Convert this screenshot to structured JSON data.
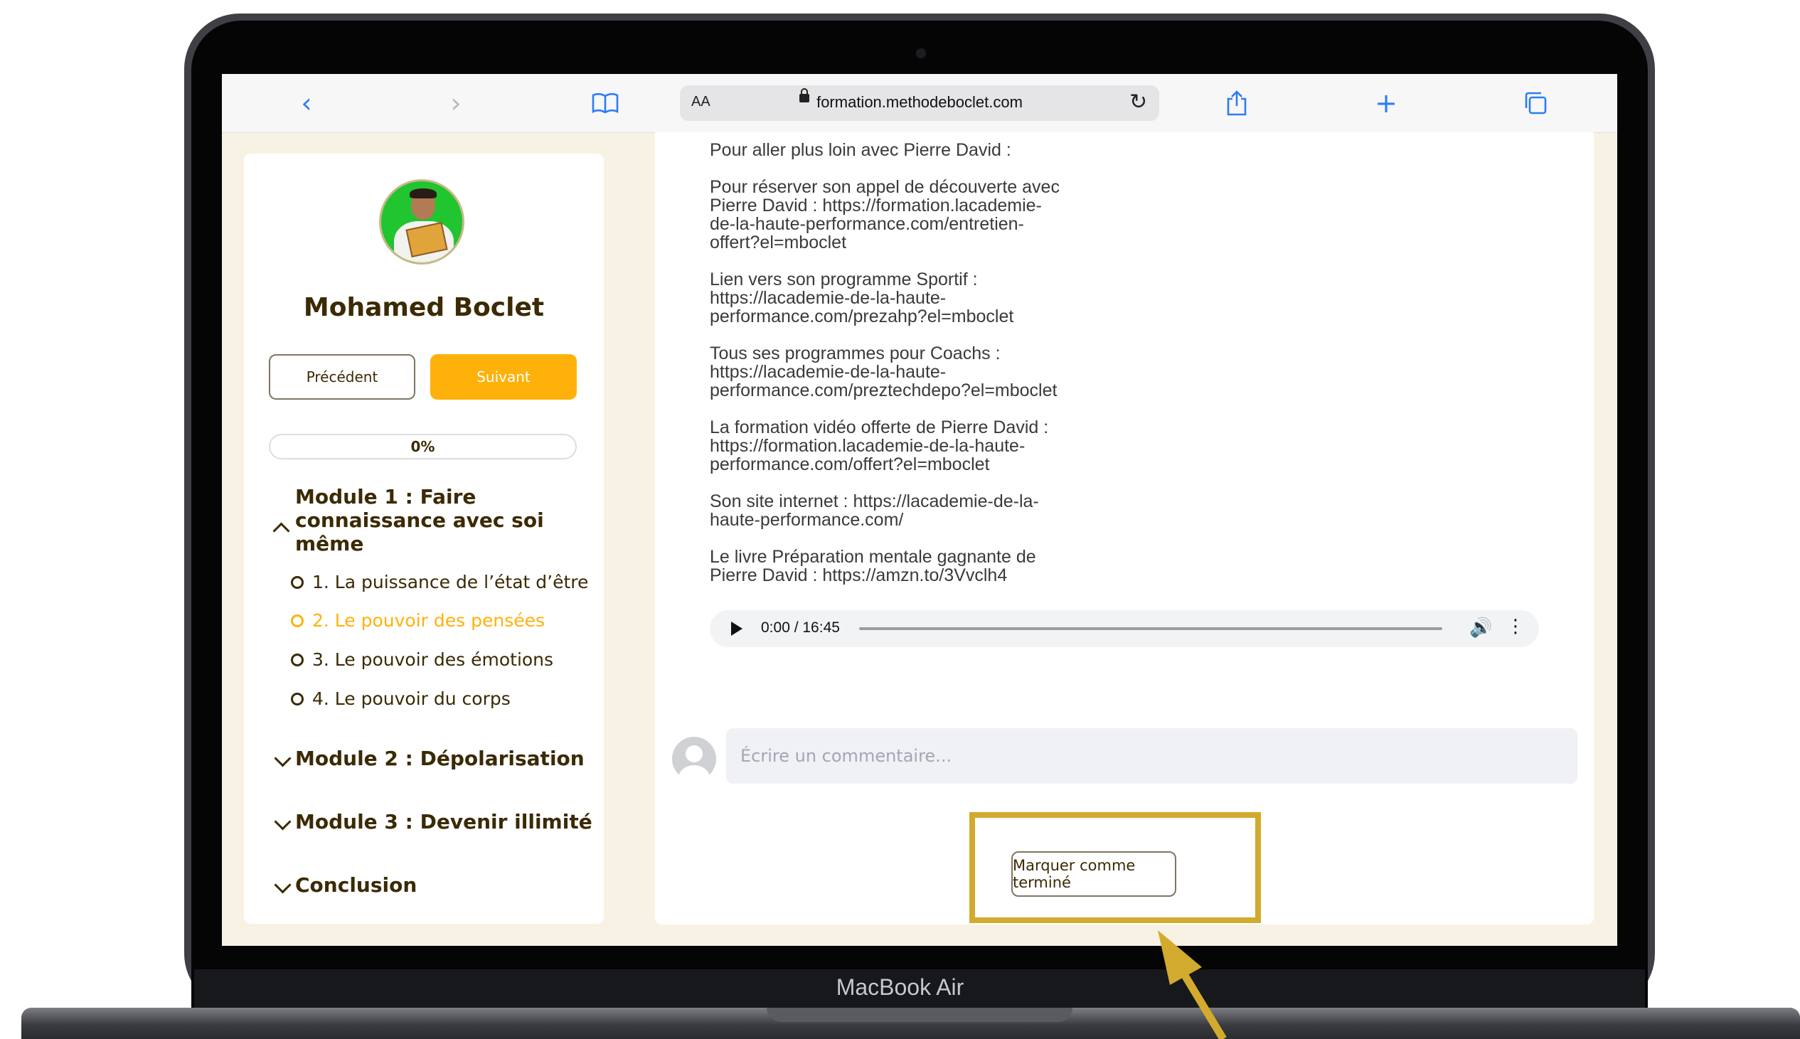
{
  "device": {
    "label": "MacBook Air"
  },
  "browser": {
    "text_size_label": "AA",
    "url": "formation.methodeboclet.com"
  },
  "sidebar": {
    "name": "Mohamed Boclet",
    "prev_label": "Précédent",
    "next_label": "Suivant",
    "progress_label": "0%",
    "progress_value": 0,
    "module_open": {
      "title": "Module 1 : Faire connaissance avec soi même",
      "lessons": [
        {
          "label": "1. La puissance de l’état d’être",
          "active": false
        },
        {
          "label": "2. Le pouvoir des pensées",
          "active": true
        },
        {
          "label": "3. Le pouvoir des émotions",
          "active": false
        },
        {
          "label": "4. Le pouvoir du corps",
          "active": false
        }
      ]
    },
    "modules_closed": [
      "Module 2 : Dépolarisation",
      "Module 3 : Devenir illimité",
      "Conclusion"
    ]
  },
  "content": {
    "blocks": [
      "Pour aller plus loin avec Pierre David :",
      "Pour réserver son appel de découverte avec\nPierre David : https://formation.lacademie-\nde-la-haute-performance.com/entretien-\noffert?el=mboclet",
      "Lien vers son programme Sportif :\nhttps://lacademie-de-la-haute-\nperformance.com/prezahp?el=mboclet",
      "Tous ses programmes pour Coachs :\nhttps://lacademie-de-la-haute-\nperformance.com/preztechdepo?el=mboclet",
      "La formation vidéo offerte de Pierre David :\nhttps://formation.lacademie-de-la-haute-\nperformance.com/offert?el=mboclet",
      "Son site internet : https://lacademie-de-la-\nhaute-performance.com/",
      "Le livre Préparation mentale gagnante de\nPierre David : https://amzn.to/3Vvclh4"
    ],
    "audio": {
      "time": "0:00 / 16:45"
    },
    "comment_placeholder": "Écrire un commentaire...",
    "complete_label": "Marquer comme terminé"
  },
  "colors": {
    "accent": "#ffb10b",
    "text": "#3b2a04",
    "background": "#f8f2e5",
    "annotation": "#d2aa2d",
    "browser_blue": "#2d7cf6"
  }
}
